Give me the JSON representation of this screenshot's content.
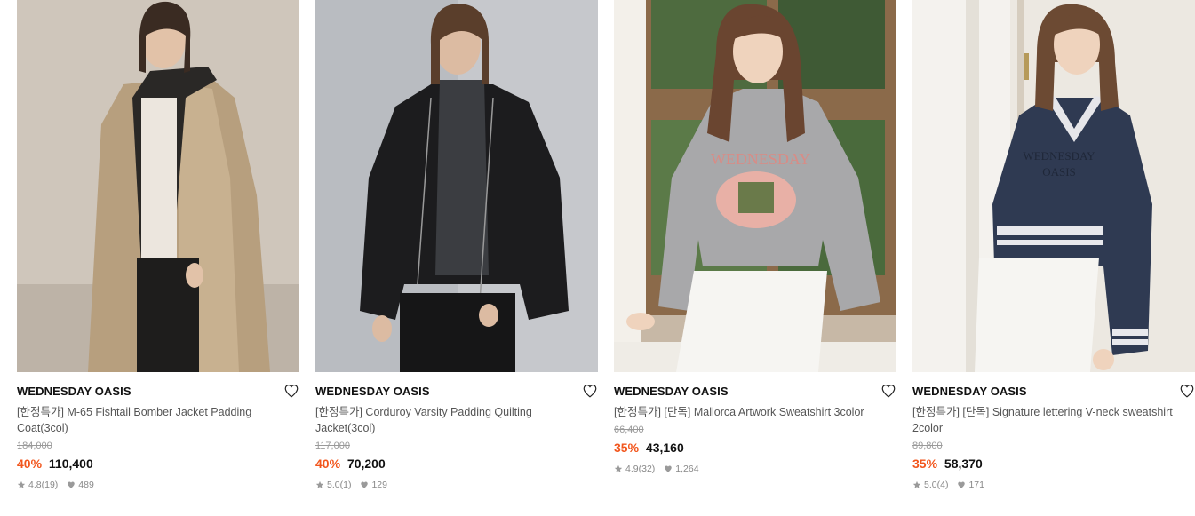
{
  "products": [
    {
      "brand": "WEDNESDAY OASIS",
      "title": "[한정특가] M-65 Fishtail Bomber Jacket Padding Coat(3col)",
      "original_price": "184,000",
      "discount": "40%",
      "price": "110,400",
      "rating": "4.8",
      "review_count": "(19)",
      "likes": "489",
      "image_alt": "Model wearing beige long fishtail padding coat with dark hood"
    },
    {
      "brand": "WEDNESDAY OASIS",
      "title": "[한정특가] Corduroy Varsity Padding Quilting Jacket(3col)",
      "original_price": "117,000",
      "discount": "40%",
      "price": "70,200",
      "rating": "5.0",
      "review_count": "(1)",
      "likes": "129",
      "image_alt": "Model wearing black corduroy quilted varsity padding jacket"
    },
    {
      "brand": "WEDNESDAY OASIS",
      "title": "[한정특가] [단독] Mallorca Artwork Sweatshirt 3color",
      "original_price": "66,400",
      "discount": "35%",
      "price": "43,160",
      "rating": "4.9",
      "review_count": "(32)",
      "likes": "1,264",
      "image_alt": "Model in grey WEDNESDAY artwork sweatshirt sitting by a window"
    },
    {
      "brand": "WEDNESDAY OASIS",
      "title": "[한정특가] [단독] Signature lettering V-neck sweatshirt 2color",
      "original_price": "89,800",
      "discount": "35%",
      "price": "58,370",
      "rating": "5.0",
      "review_count": "(4)",
      "likes": "171",
      "image_alt": "Model in navy V-neck lettering sweatshirt with striped cuffs"
    }
  ],
  "colors": {
    "discount": "#f2561d",
    "brand_text": "#111111",
    "muted": "#888888"
  },
  "icons": {
    "wish": "heart-outline-icon",
    "rating": "star-icon",
    "likes": "heart-filled-icon"
  }
}
